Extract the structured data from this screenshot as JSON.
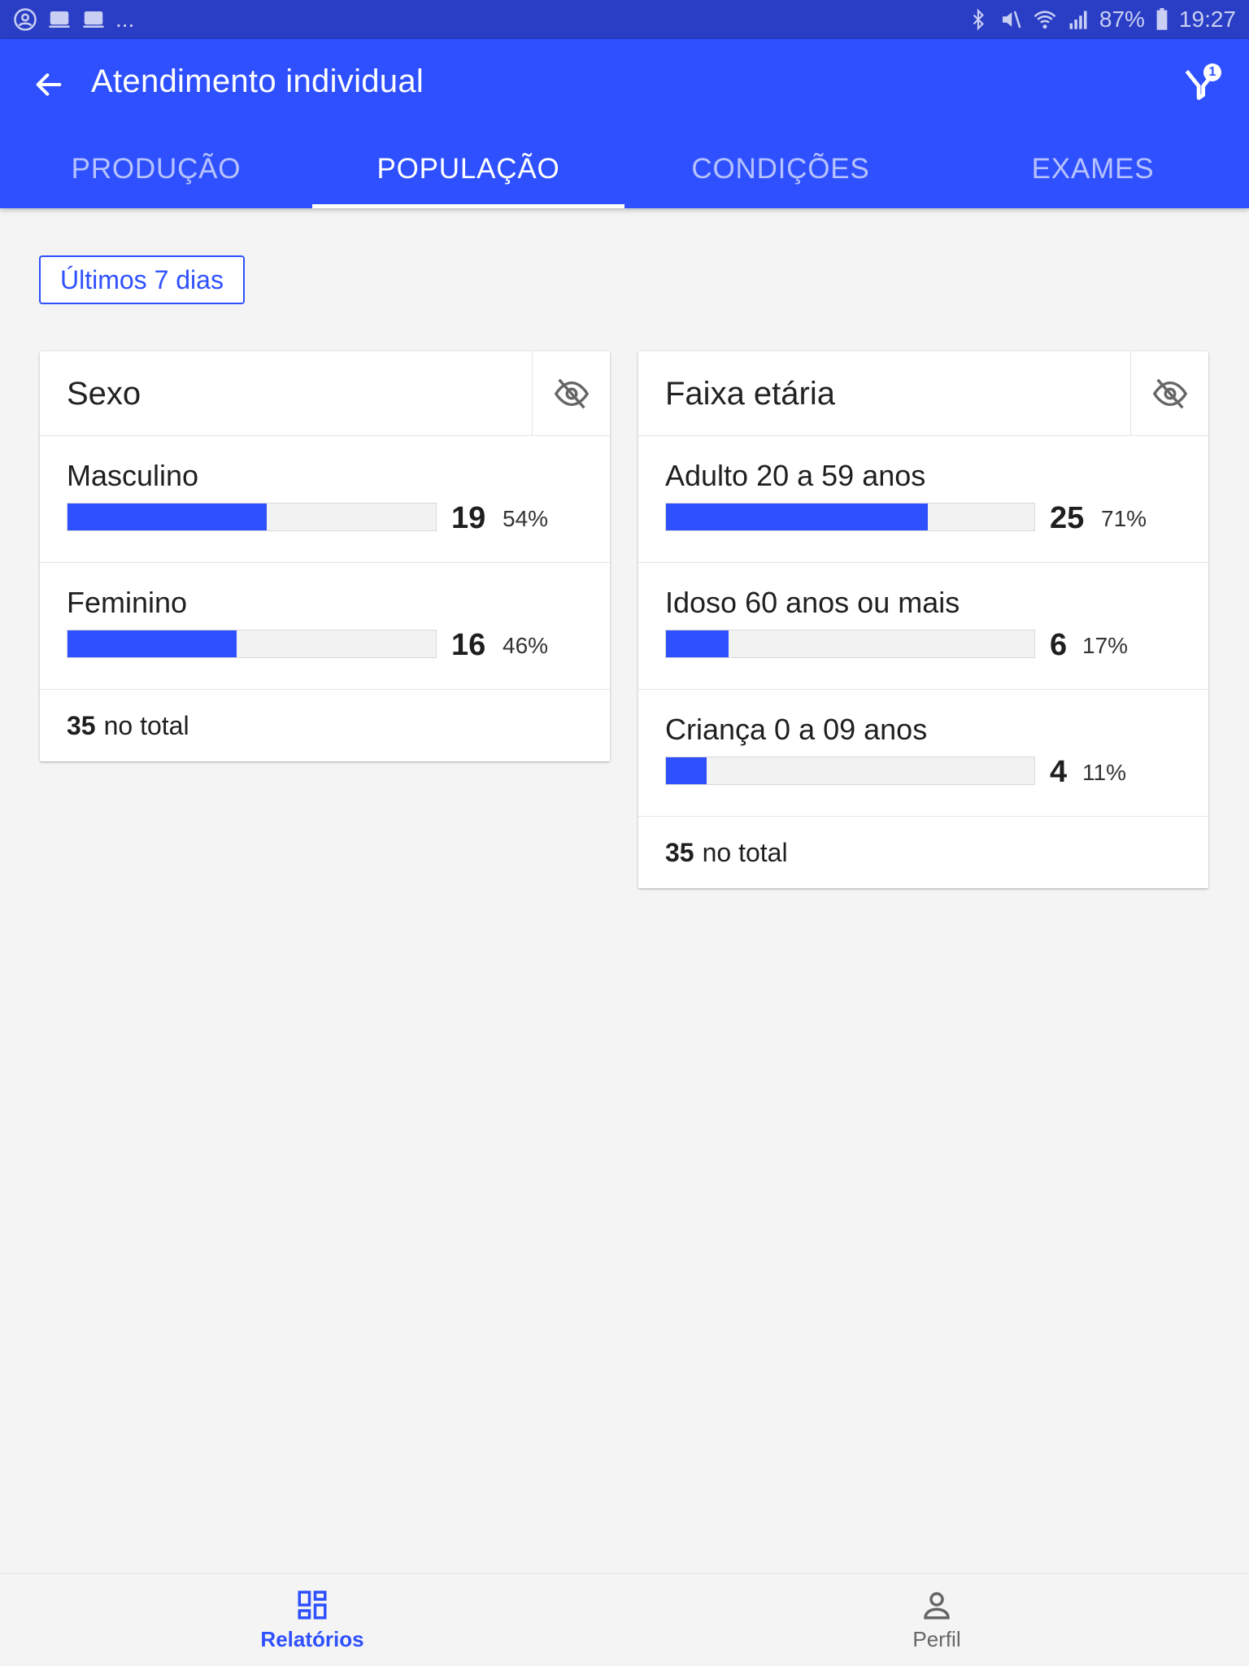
{
  "status_bar": {
    "left_more": "...",
    "battery": "87%",
    "time": "19:27"
  },
  "app_bar": {
    "title": "Atendimento individual",
    "filter_badge": "1"
  },
  "tabs": [
    {
      "label": "PRODUÇÃO",
      "active": false
    },
    {
      "label": "POPULAÇÃO",
      "active": true
    },
    {
      "label": "CONDIÇÕES",
      "active": false
    },
    {
      "label": "EXAMES",
      "active": false
    }
  ],
  "period_chip": "Últimos 7 dias",
  "cards": {
    "sexo": {
      "title": "Sexo",
      "rows": [
        {
          "label": "Masculino",
          "count": "19",
          "pct": "54%",
          "fraction": 0.54
        },
        {
          "label": "Feminino",
          "count": "16",
          "pct": "46%",
          "fraction": 0.46
        }
      ],
      "total_num": "35",
      "total_text": "no total"
    },
    "faixa": {
      "title": "Faixa etária",
      "rows": [
        {
          "label": "Adulto 20 a 59 anos",
          "count": "25",
          "pct": "71%",
          "fraction": 0.71
        },
        {
          "label": "Idoso 60 anos ou mais",
          "count": "6",
          "pct": "17%",
          "fraction": 0.17
        },
        {
          "label": "Criança 0 a 09 anos",
          "count": "4",
          "pct": "11%",
          "fraction": 0.11
        }
      ],
      "total_num": "35",
      "total_text": "no total"
    }
  },
  "bottom_nav": [
    {
      "label": "Relatórios",
      "icon": "dashboard-icon",
      "active": true
    },
    {
      "label": "Perfil",
      "icon": "person-icon",
      "active": false
    }
  ],
  "colors": {
    "primary": "#2e50ff",
    "status_bar": "#2a3ec5",
    "background": "#f4f4f4"
  }
}
